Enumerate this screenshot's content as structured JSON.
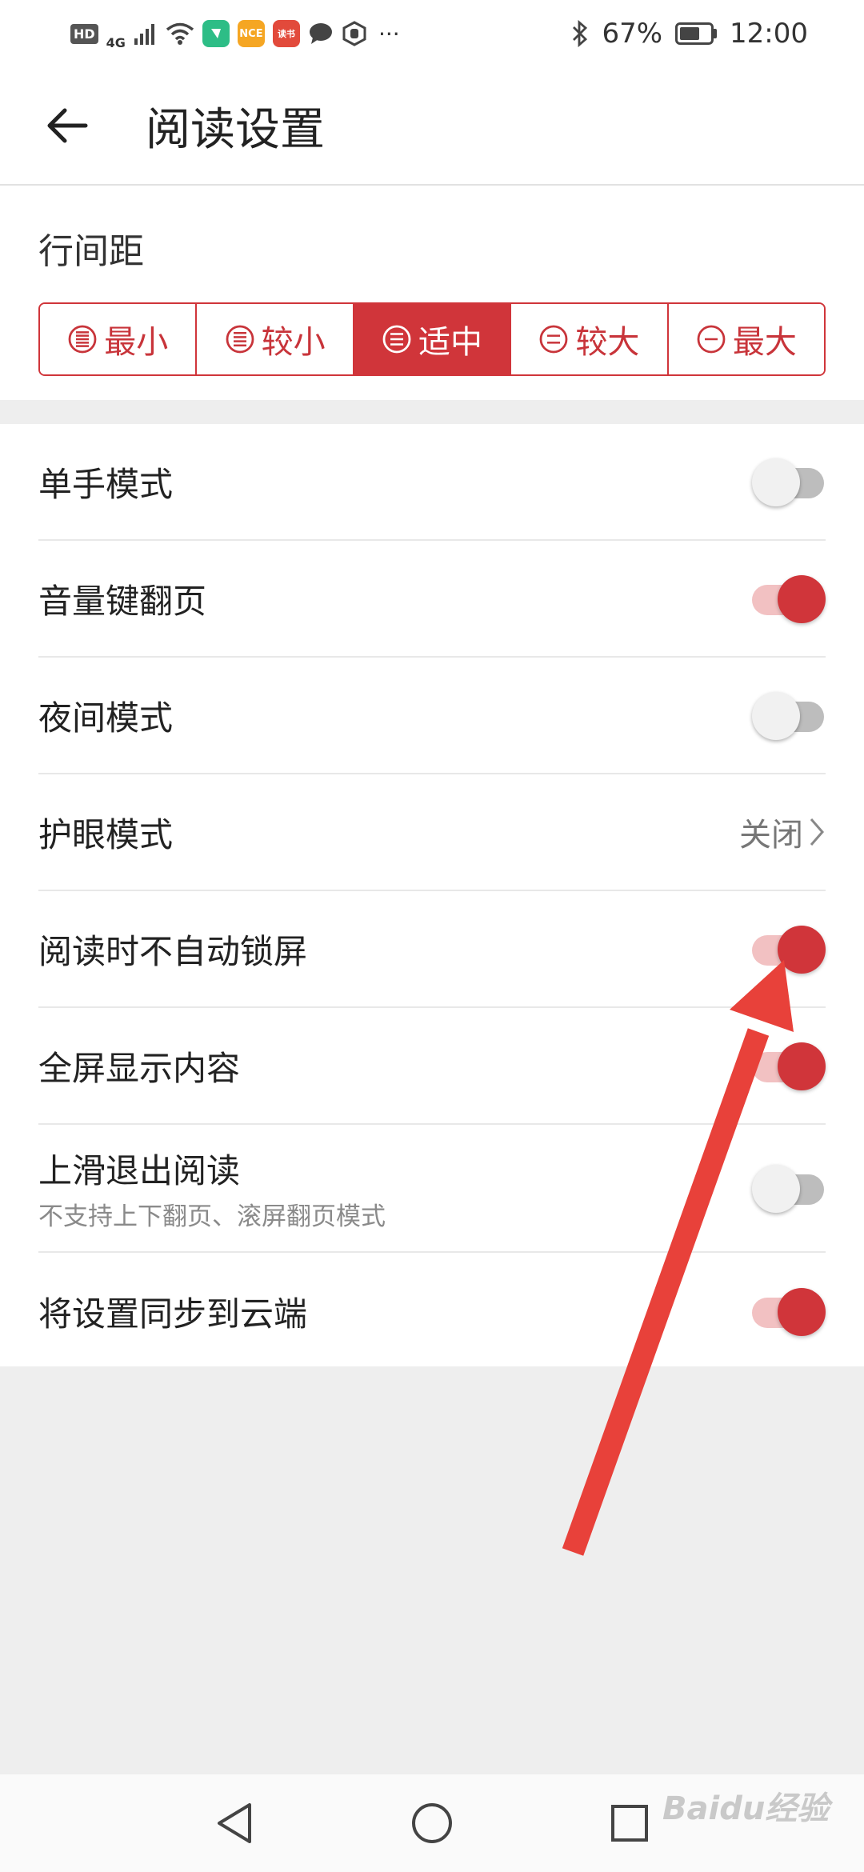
{
  "status_bar": {
    "network": "4G",
    "hd": "HD",
    "app_badges": [
      "NCE",
      "读书"
    ],
    "more": "···",
    "battery": "67%",
    "battery_level": 0.67,
    "time": "12:00"
  },
  "header": {
    "title": "阅读设置"
  },
  "line_spacing": {
    "label": "行间距",
    "options": [
      "最小",
      "较小",
      "适中",
      "较大",
      "最大"
    ],
    "selected": "适中"
  },
  "settings": [
    {
      "label": "单手模式",
      "type": "toggle",
      "on": false
    },
    {
      "label": "音量键翻页",
      "type": "toggle",
      "on": true
    },
    {
      "label": "夜间模式",
      "type": "toggle",
      "on": false
    },
    {
      "label": "护眼模式",
      "type": "link",
      "value": "关闭"
    },
    {
      "label": "阅读时不自动锁屏",
      "type": "toggle",
      "on": true
    },
    {
      "label": "全屏显示内容",
      "type": "toggle",
      "on": true
    },
    {
      "label": "上滑退出阅读",
      "sublabel": "不支持上下翻页、滚屏翻页模式",
      "type": "toggle",
      "on": false
    },
    {
      "label": "将设置同步到云端",
      "type": "toggle",
      "on": true
    }
  ],
  "colors": {
    "accent": "#d0353a",
    "toggle_on_track": "#f2c1c2",
    "toggle_off_track": "#bdbdbd",
    "annotation_arrow": "#e8413a"
  },
  "watermark": "Baidu经验"
}
